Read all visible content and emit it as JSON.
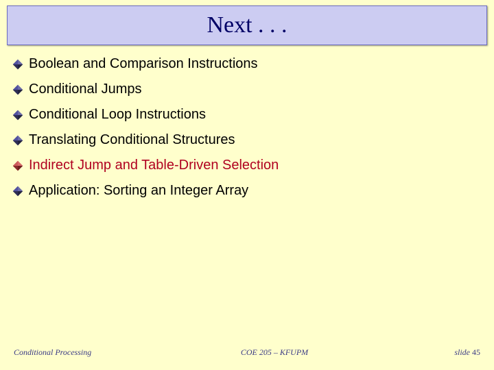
{
  "title": "Next . . .",
  "bullets": [
    {
      "text": "Boolean and Comparison Instructions",
      "hl": false
    },
    {
      "text": "Conditional Jumps",
      "hl": false
    },
    {
      "text": "Conditional Loop Instructions",
      "hl": false
    },
    {
      "text": "Translating Conditional Structures",
      "hl": false
    },
    {
      "text": "Indirect Jump and Table-Driven Selection",
      "hl": true
    },
    {
      "text": "Application: Sorting an Integer Array",
      "hl": false
    }
  ],
  "footer": {
    "left": "Conditional Processing",
    "mid": "COE 205 – KFUPM",
    "right_label": "slide ",
    "right_num": "45"
  },
  "colors": {
    "bullet_dark": "#3b3b6b",
    "bullet_red": "#b43a3a"
  }
}
